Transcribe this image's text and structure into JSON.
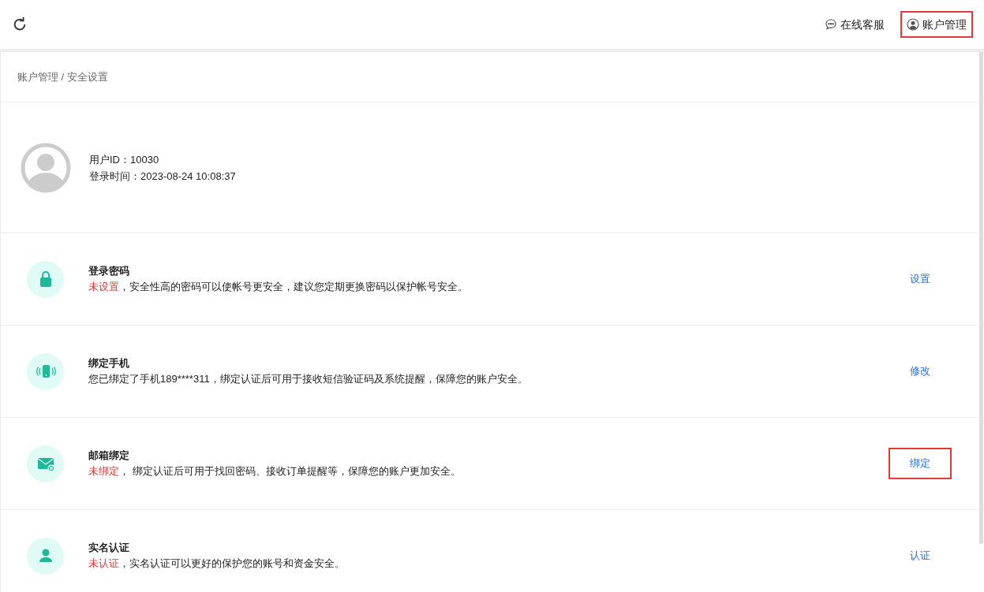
{
  "header": {
    "links": [
      {
        "label": "在线客服",
        "highlighted": false
      },
      {
        "label": "账户管理",
        "highlighted": true
      }
    ]
  },
  "breadcrumb": "账户管理 / 安全设置",
  "profile": {
    "user_id": "用户ID：10030",
    "login_time": "登录时间：2023-08-24 10:08:37"
  },
  "settings": [
    {
      "title": "登录密码",
      "status": "未设置",
      "text": "，安全性高的密码可以使帐号更安全，建议您定期更换密码以保护帐号安全。",
      "action": "设置",
      "highlighted": false
    },
    {
      "title": "绑定手机",
      "text": "您已绑定了手机189****311，绑定认证后可用于接收短信验证码及系统提醒，保障您的账户安全。",
      "action": "修改",
      "highlighted": false
    },
    {
      "title": "邮箱绑定",
      "status": "未绑定",
      "text": "， 绑定认证后可用于找回密码、接收订单提醒等，保障您的账户更加安全。",
      "action": "绑定",
      "highlighted": true
    },
    {
      "title": "实名认证",
      "status": "未认证",
      "text": "，实名认证可以更好的保护您的账号和资金安全。",
      "action": "认证",
      "highlighted": false
    }
  ]
}
